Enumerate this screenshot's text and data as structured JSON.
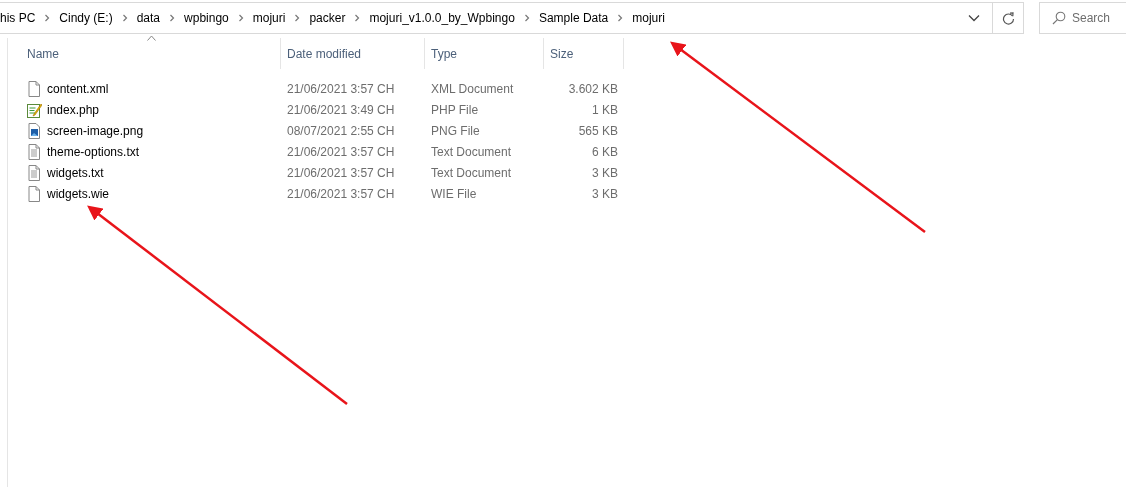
{
  "address_bar": {
    "breadcrumbs": [
      "his PC",
      "Cindy (E:)",
      "data",
      "wpbingo",
      "mojuri",
      "packer",
      "mojuri_v1.0.0_by_Wpbingo",
      "Sample Data",
      "mojuri"
    ]
  },
  "search": {
    "placeholder": "Search"
  },
  "file_list": {
    "columns": [
      {
        "label": "Name",
        "sorted": true
      },
      {
        "label": "Date modified",
        "sorted": false
      },
      {
        "label": "Type",
        "sorted": false
      },
      {
        "label": "Size",
        "sorted": false
      }
    ],
    "rows": [
      {
        "name": "content.xml",
        "kind": "blank",
        "date_modified": "21/06/2021 3:57 CH",
        "type": "XML Document",
        "size": "3.602 KB"
      },
      {
        "name": "index.php",
        "kind": "php",
        "date_modified": "21/06/2021 3:49 CH",
        "type": "PHP File",
        "size": "1 KB"
      },
      {
        "name": "screen-image.png",
        "kind": "image",
        "date_modified": "08/07/2021 2:55 CH",
        "type": "PNG File",
        "size": "565 KB"
      },
      {
        "name": "theme-options.txt",
        "kind": "text",
        "date_modified": "21/06/2021 3:57 CH",
        "type": "Text Document",
        "size": "6 KB"
      },
      {
        "name": "widgets.txt",
        "kind": "text",
        "date_modified": "21/06/2021 3:57 CH",
        "type": "Text Document",
        "size": "3 KB"
      },
      {
        "name": "widgets.wie",
        "kind": "blank",
        "date_modified": "21/06/2021 3:57 CH",
        "type": "WIE File",
        "size": "3 KB"
      }
    ]
  }
}
